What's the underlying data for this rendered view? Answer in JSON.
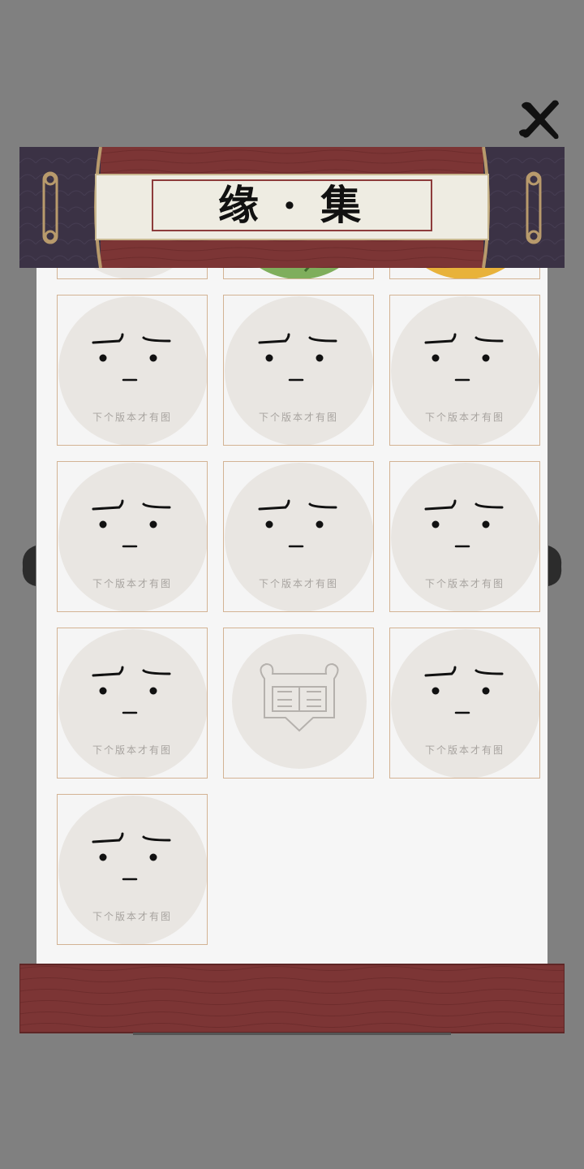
{
  "title": "缘 · 集",
  "watermark": "下个版本才有图",
  "colors": {
    "backdrop": "#808080",
    "paper": "#f6f6f6",
    "card_border": "#d3b394",
    "face_circle": "#e9e6e2",
    "scroll_red": "#7c3535",
    "scroll_purple": "#3b3245",
    "title_panel": "#eeece2"
  },
  "cards": [
    {
      "type": "face"
    },
    {
      "type": "face"
    },
    {
      "type": "face"
    },
    {
      "type": "face"
    },
    {
      "type": "face"
    },
    {
      "type": "face"
    },
    {
      "type": "face"
    },
    {
      "type": "seal"
    },
    {
      "type": "face"
    },
    {
      "type": "face"
    }
  ],
  "partial_cards": [
    {
      "type": "face"
    },
    {
      "type": "leaf-art"
    },
    {
      "type": "gold-art"
    }
  ],
  "icons": {
    "close": "close-brush-x-icon",
    "seal": "seal-stamp-icon"
  }
}
